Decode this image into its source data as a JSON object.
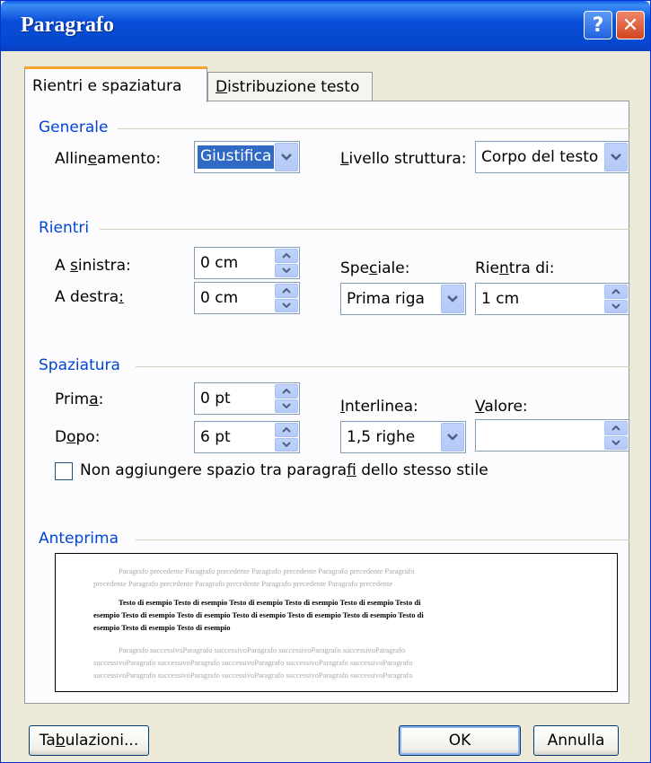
{
  "window": {
    "title": "Paragrafo"
  },
  "titlebar": {
    "help_glyph": "?",
    "close_glyph": "✕"
  },
  "tabs": [
    {
      "label": "Rientri e spaziatura",
      "active": true
    },
    {
      "label_pre": "",
      "label_ul": "D",
      "label_post": "istribuzione testo",
      "active": false
    }
  ],
  "generale": {
    "heading": "Generale",
    "alignment_label_pre": "Allin",
    "alignment_label_ul": "e",
    "alignment_label_post": "amento:",
    "alignment_value": "Giustifica",
    "outline_label_ul": "L",
    "outline_label_post": "ivello struttura:",
    "outline_value": "Corpo del testo"
  },
  "rientri": {
    "heading": "Rientri",
    "left_label_pre": "A ",
    "left_label_ul": "s",
    "left_label_post": "inistra:",
    "left_value": "0 cm",
    "right_label_pre": "A destra",
    "right_label_ul": ":",
    "right_value": "0 cm",
    "special_label_pre": "Spe",
    "special_label_ul": "c",
    "special_label_post": "iale:",
    "special_value": "Prima riga",
    "by_label_pre": "Rie",
    "by_label_ul": "n",
    "by_label_post": "tra di:",
    "by_value": "1 cm"
  },
  "spaziatura": {
    "heading": "Spaziatura",
    "before_label_pre": "Prim",
    "before_label_ul": "a",
    "before_label_post": ":",
    "before_value": "0 pt",
    "after_label_pre": "D",
    "after_label_ul": "o",
    "after_label_post": "po:",
    "after_value": "6 pt",
    "linespacing_label_ul": "I",
    "linespacing_label_post": "nterlinea:",
    "linespacing_value": "1,5 righe",
    "at_label_ul": "V",
    "at_label_post": "alore:",
    "at_value": "",
    "dont_add_space_pre": "Non aggiungere spazio tra paragra",
    "dont_add_space_ul": "f",
    "dont_add_space_post": "i dello stesso stile",
    "dont_add_space_checked": false
  },
  "anteprima": {
    "heading": "Anteprima",
    "prev_lines": [
      "Paragrafo precedente Paragrafo precedente Paragrafo precedente Paragrafo precedente Paragrafo",
      "precedente Paragrafo precedente Paragrafo precedente Paragrafo precedente Paragrafo precedente"
    ],
    "body_lines": [
      "Testo di esempio Testo di esempio Testo di esempio Testo di esempio Testo di esempio Testo di",
      "esempio Testo di esempio Testo di esempio Testo di esempio Testo di esempio Testo di esempio Testo di",
      "esempio Testo di esempio Testo di esempio"
    ],
    "next_lines": [
      "Paragrafo successivoParagrafo successivoParagrafo successivoParagrafo successivoParagrafo",
      "successivoParagrafo successivoParagrafo successivoParagrafo successivoParagrafo successivoParagrafo",
      "successivoParagrafo successivoParagrafo successivoParagrafo successivoParagrafo successivoParagrafo"
    ]
  },
  "footer": {
    "tabs_btn_pre": "Ta",
    "tabs_btn_ul": "b",
    "tabs_btn_post": "ulazioni...",
    "ok_label": "OK",
    "cancel_label": "Annulla"
  }
}
